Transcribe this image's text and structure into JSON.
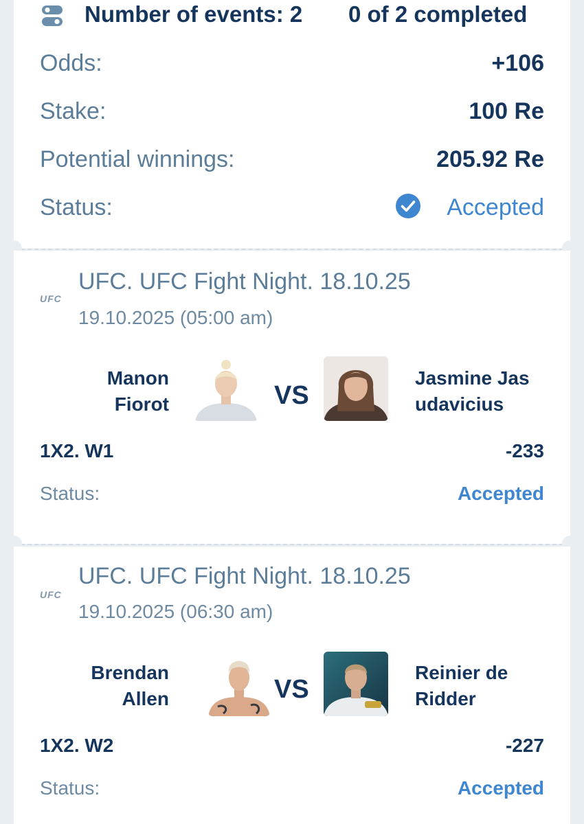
{
  "summary": {
    "events_label": "Number of events: 2",
    "completed_label": "0 of 2 completed",
    "rows": [
      {
        "label": "Odds:",
        "value": "+106"
      },
      {
        "label": "Stake:",
        "value": "100 Re"
      },
      {
        "label": "Potential winnings:",
        "value": "205.92 Re"
      }
    ],
    "status_label": "Status:",
    "status_value": "Accepted"
  },
  "events": [
    {
      "logo": "UFC",
      "title": "UFC. UFC Fight Night. 18.10.25",
      "datetime": "19.10.2025 (05:00 am)",
      "fighter1": [
        "Manon",
        "Fiorot"
      ],
      "fighter2": [
        "Jasmine Jas",
        "udavicius"
      ],
      "vs": "VS",
      "market": "1X2. W1",
      "odds": "-233",
      "status_label": "Status:",
      "status_value": "Accepted"
    },
    {
      "logo": "UFC",
      "title": "UFC. UFC Fight Night. 18.10.25",
      "datetime": "19.10.2025 (06:30 am)",
      "fighter1": [
        "Brendan",
        "Allen"
      ],
      "fighter2": [
        "Reinier de",
        "Ridder"
      ],
      "vs": "VS",
      "market": "1X2. W2",
      "odds": "-227",
      "status_label": "Status:",
      "status_value": "Accepted"
    }
  ],
  "colors": {
    "navy": "#15355c",
    "muted": "#5b7d99",
    "accent": "#3f86d0",
    "background": "#e9eef3"
  },
  "icons": {
    "header": "events-list-icon",
    "status": "check-circle-icon"
  }
}
